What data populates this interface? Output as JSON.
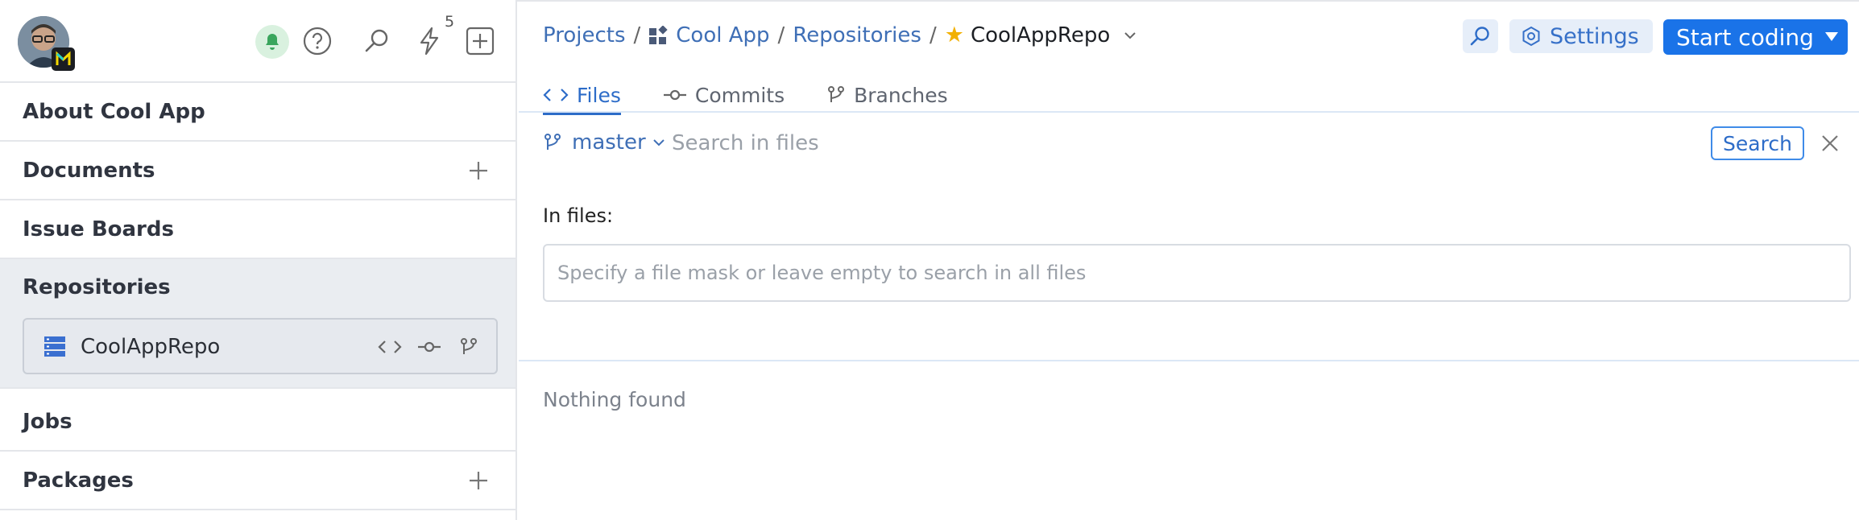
{
  "sidebar": {
    "avatar_alt": "User avatar",
    "notification_count": "5",
    "icons": [
      "bell-icon",
      "help-icon",
      "search-icon",
      "lightning-icon",
      "add-icon"
    ],
    "items": [
      {
        "label": "About Cool App",
        "has_add": false
      },
      {
        "label": "Documents",
        "has_add": true
      },
      {
        "label": "Issue Boards",
        "has_add": false
      },
      {
        "label": "Repositories",
        "has_add": false,
        "active": true
      },
      {
        "label": "Jobs",
        "has_add": false
      },
      {
        "label": "Packages",
        "has_add": true
      }
    ],
    "repo": {
      "label": "CoolAppRepo",
      "actions": [
        "code-icon",
        "commit-icon",
        "branch-icon"
      ]
    }
  },
  "breadcrumb": {
    "projects": "Projects",
    "project": "Cool App",
    "section": "Repositories",
    "current": "CoolAppRepo"
  },
  "toolbar": {
    "settings_label": "Settings",
    "start_label": "Start coding"
  },
  "tabs": [
    {
      "label": "Files",
      "icon": "code-icon",
      "active": true
    },
    {
      "label": "Commits",
      "icon": "commit-icon",
      "active": false
    },
    {
      "label": "Branches",
      "icon": "branch-icon",
      "active": false
    }
  ],
  "search": {
    "branch": "master",
    "placeholder": "Search in files",
    "button_label": "Search",
    "in_files_label": "In files:",
    "mask_placeholder": "Specify a file mask or leave empty to search in all files"
  },
  "results": {
    "empty_text": "Nothing found"
  },
  "colors": {
    "accent": "#1a73e8",
    "link": "#3f6fb6",
    "star": "#f2b000",
    "bell_bg": "#d9f1df",
    "bell": "#3aa55d"
  }
}
